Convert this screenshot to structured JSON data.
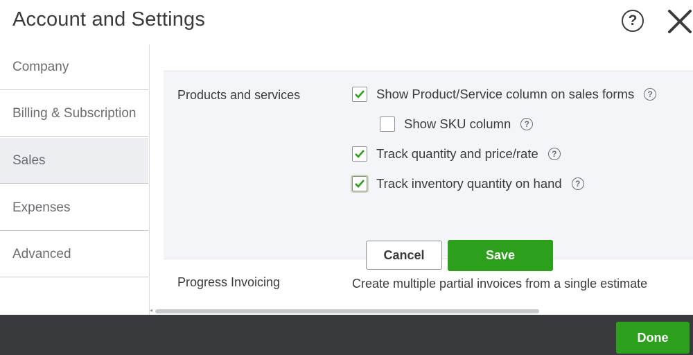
{
  "header": {
    "title": "Account and Settings",
    "help_glyph": "?"
  },
  "sidebar": {
    "items": [
      {
        "label": "Company"
      },
      {
        "label": "Billing & Subscription"
      },
      {
        "label": "Sales"
      },
      {
        "label": "Expenses"
      },
      {
        "label": "Advanced"
      }
    ],
    "active": "Sales"
  },
  "content": {
    "products": {
      "section_label": "Products and services",
      "options": [
        {
          "label": "Show Product/Service column on sales forms",
          "checked": true
        },
        {
          "label": "Show SKU column",
          "checked": false
        },
        {
          "label": "Track quantity and price/rate",
          "checked": true
        },
        {
          "label": "Track inventory quantity on hand",
          "checked": true
        }
      ],
      "cancel_label": "Cancel",
      "save_label": "Save"
    },
    "progress": {
      "section_label": "Progress Invoicing",
      "description": "Create multiple partial invoices from a single estimate"
    }
  },
  "footer": {
    "done_label": "Done"
  },
  "colors": {
    "accent_green": "#2ca01c",
    "footer_bg": "#393a3d",
    "panel_bg": "#f4f5f8"
  },
  "icons": {
    "help": "help-circle-icon",
    "close": "close-icon",
    "checkbox_checked": "checkmark-icon",
    "info": "question-circle-icon"
  }
}
